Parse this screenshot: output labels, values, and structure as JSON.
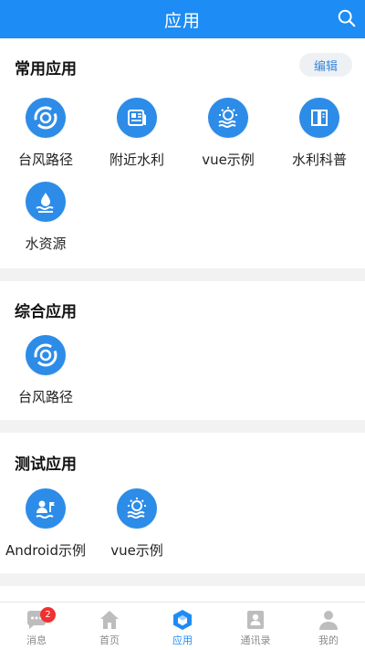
{
  "header": {
    "title": "应用",
    "search_icon": "search-icon"
  },
  "sections": [
    {
      "title": "常用应用",
      "edit_label": "编辑",
      "apps": [
        {
          "label": "台风路径",
          "icon": "typhoon-icon"
        },
        {
          "label": "附近水利",
          "icon": "news-icon"
        },
        {
          "label": "vue示例",
          "icon": "water-wave-gear-icon"
        },
        {
          "label": "水利科普",
          "icon": "book-icon"
        },
        {
          "label": "水资源",
          "icon": "water-drop-icon"
        }
      ]
    },
    {
      "title": "综合应用",
      "apps": [
        {
          "label": "台风路径",
          "icon": "typhoon-icon"
        }
      ]
    },
    {
      "title": "测试应用",
      "apps": [
        {
          "label": "Android示例",
          "icon": "person-flag-icon"
        },
        {
          "label": "vue示例",
          "icon": "water-wave-gear-icon"
        }
      ]
    }
  ],
  "tabbar": {
    "items": [
      {
        "label": "消息",
        "icon": "chat-icon",
        "badge": "2"
      },
      {
        "label": "首页",
        "icon": "home-icon"
      },
      {
        "label": "应用",
        "icon": "cube-icon",
        "active": true
      },
      {
        "label": "通讯录",
        "icon": "contacts-icon"
      },
      {
        "label": "我的",
        "icon": "user-icon"
      }
    ]
  },
  "colors": {
    "primary": "#1d8cf4",
    "icon_bg": "#2c8ce8",
    "badge": "#f23030"
  }
}
